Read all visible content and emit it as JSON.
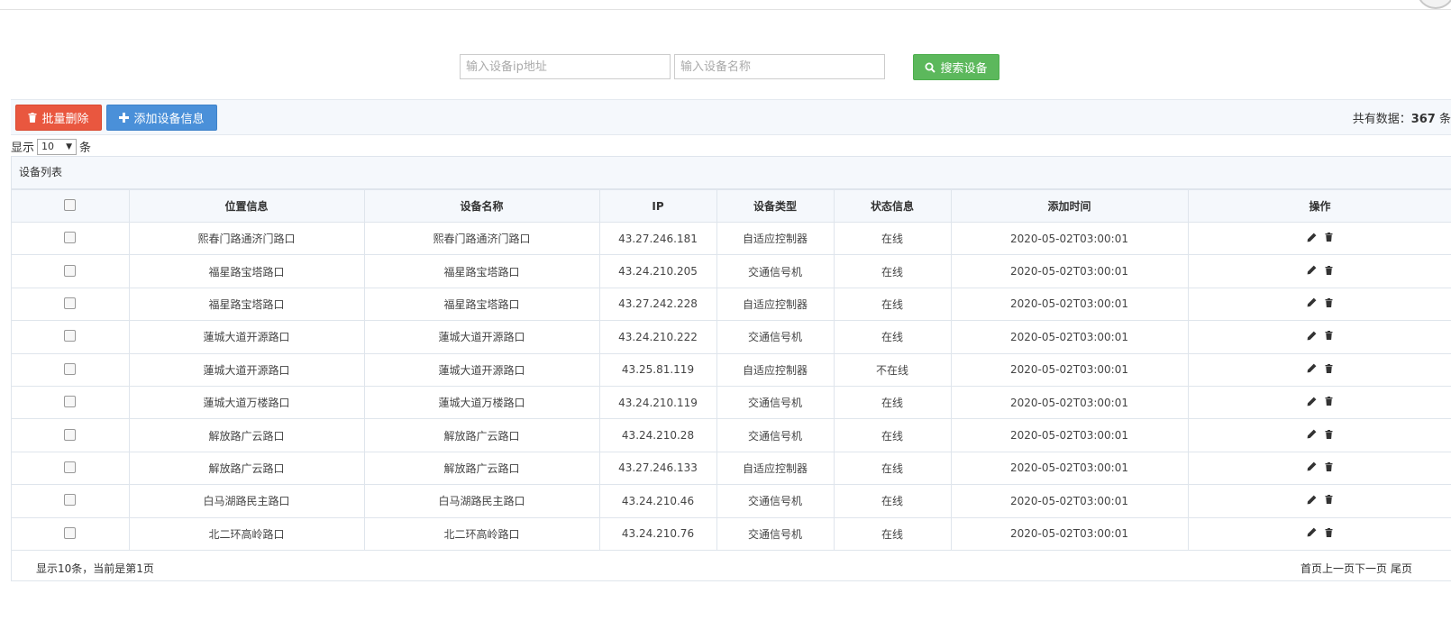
{
  "search": {
    "ip_placeholder": "输入设备ip地址",
    "name_placeholder": "输入设备名称",
    "button_label": "搜索设备"
  },
  "toolbar": {
    "batch_delete_label": "批量删除",
    "add_label": "添加设备信息",
    "total_prefix": "共有数据：",
    "total_count": "367",
    "total_suffix": "条"
  },
  "page_size": {
    "prefix": "显示",
    "value": "10",
    "suffix": "条"
  },
  "panel_title": "设备列表",
  "columns": [
    "位置信息",
    "设备名称",
    "IP",
    "设备类型",
    "状态信息",
    "添加时间",
    "操作"
  ],
  "rows": [
    {
      "location": "熙春门路通济门路口",
      "name": "熙春门路通济门路口",
      "ip": "43.27.246.181",
      "type": "自适应控制器",
      "status": "在线",
      "time": "2020-05-02T03:00:01"
    },
    {
      "location": "福星路宝塔路口",
      "name": "福星路宝塔路口",
      "ip": "43.24.210.205",
      "type": "交通信号机",
      "status": "在线",
      "time": "2020-05-02T03:00:01"
    },
    {
      "location": "福星路宝塔路口",
      "name": "福星路宝塔路口",
      "ip": "43.27.242.228",
      "type": "自适应控制器",
      "status": "在线",
      "time": "2020-05-02T03:00:01"
    },
    {
      "location": "蓮城大道开源路口",
      "name": "蓮城大道开源路口",
      "ip": "43.24.210.222",
      "type": "交通信号机",
      "status": "在线",
      "time": "2020-05-02T03:00:01"
    },
    {
      "location": "蓮城大道开源路口",
      "name": "蓮城大道开源路口",
      "ip": "43.25.81.119",
      "type": "自适应控制器",
      "status": "不在线",
      "time": "2020-05-02T03:00:01"
    },
    {
      "location": "蓮城大道万楼路口",
      "name": "蓮城大道万楼路口",
      "ip": "43.24.210.119",
      "type": "交通信号机",
      "status": "在线",
      "time": "2020-05-02T03:00:01"
    },
    {
      "location": "解放路广云路口",
      "name": "解放路广云路口",
      "ip": "43.24.210.28",
      "type": "交通信号机",
      "status": "在线",
      "time": "2020-05-02T03:00:01"
    },
    {
      "location": "解放路广云路口",
      "name": "解放路广云路口",
      "ip": "43.27.246.133",
      "type": "自适应控制器",
      "status": "在线",
      "time": "2020-05-02T03:00:01"
    },
    {
      "location": "白马湖路民主路口",
      "name": "白马湖路民主路口",
      "ip": "43.24.210.46",
      "type": "交通信号机",
      "status": "在线",
      "time": "2020-05-02T03:00:01"
    },
    {
      "location": "北二环高岭路口",
      "name": "北二环高岭路口",
      "ip": "43.24.210.76",
      "type": "交通信号机",
      "status": "在线",
      "time": "2020-05-02T03:00:01"
    }
  ],
  "footer": {
    "info": "显示10条，当前是第1页",
    "first": "首页",
    "prev": "上一页",
    "next": "下一页",
    "last": "尾页"
  },
  "icons": {
    "search": "search-icon",
    "delete": "trash-icon",
    "add": "plus-icon",
    "edit": "pencil-icon"
  },
  "colors": {
    "search_button": "#5cb85c",
    "delete_button": "#e9573f",
    "add_button": "#4a90d9"
  }
}
